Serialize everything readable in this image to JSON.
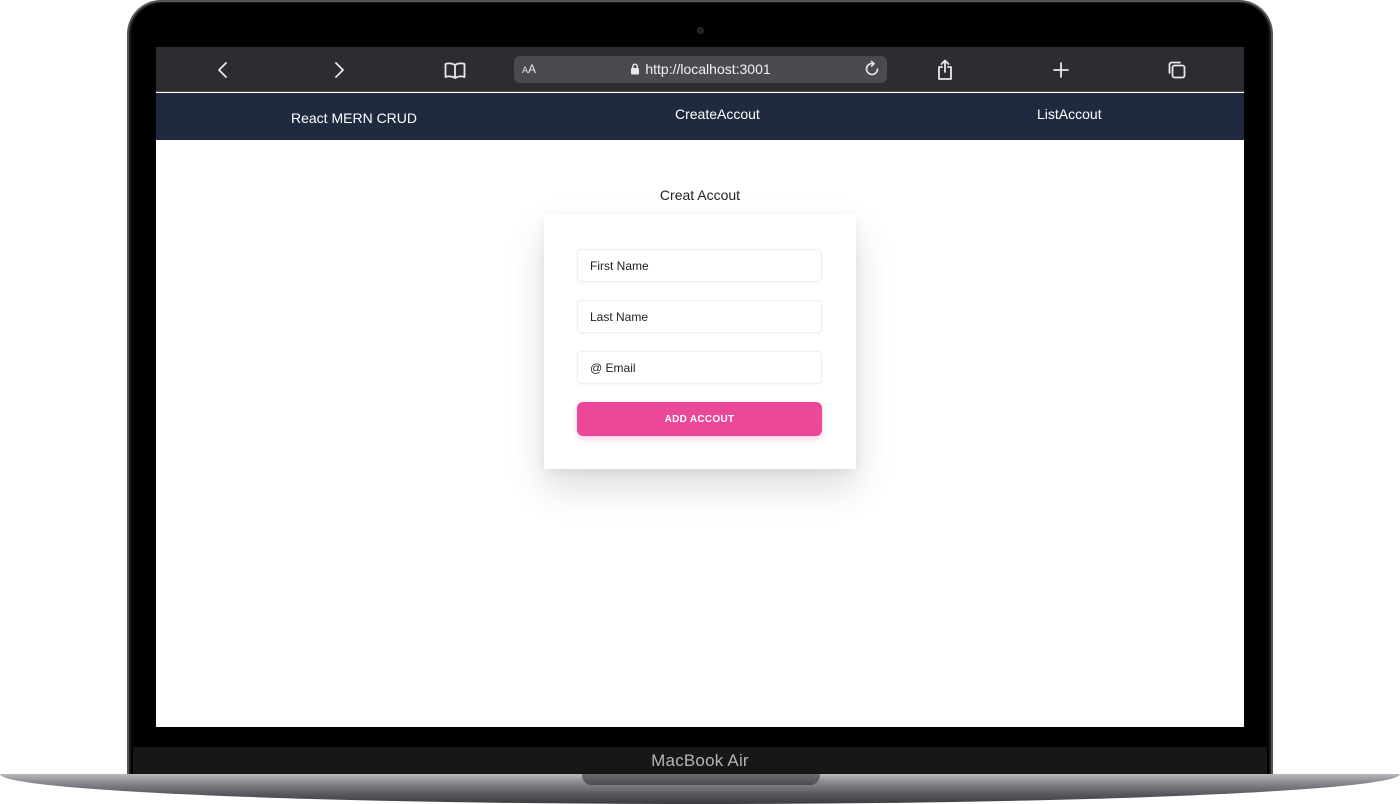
{
  "device": {
    "label": "MacBook Air"
  },
  "browser": {
    "text_size_label": "AA",
    "url": "http://localhost:3001",
    "icons": [
      "back-icon",
      "forward-icon",
      "bookmarks-icon",
      "lock-icon",
      "reload-icon",
      "share-icon",
      "new-tab-icon",
      "tabs-icon"
    ]
  },
  "navbar": {
    "brand": "React MERN CRUD",
    "links": [
      "CreateAccout",
      "ListAccout"
    ],
    "background": "#1f2a3e"
  },
  "page": {
    "title": "Creat Accout"
  },
  "form": {
    "first_name_placeholder": "First Name",
    "last_name_placeholder": "Last Name",
    "email_placeholder": "@ Email",
    "submit_label": "ADD ACCOUT",
    "accent": "#ec4899"
  }
}
